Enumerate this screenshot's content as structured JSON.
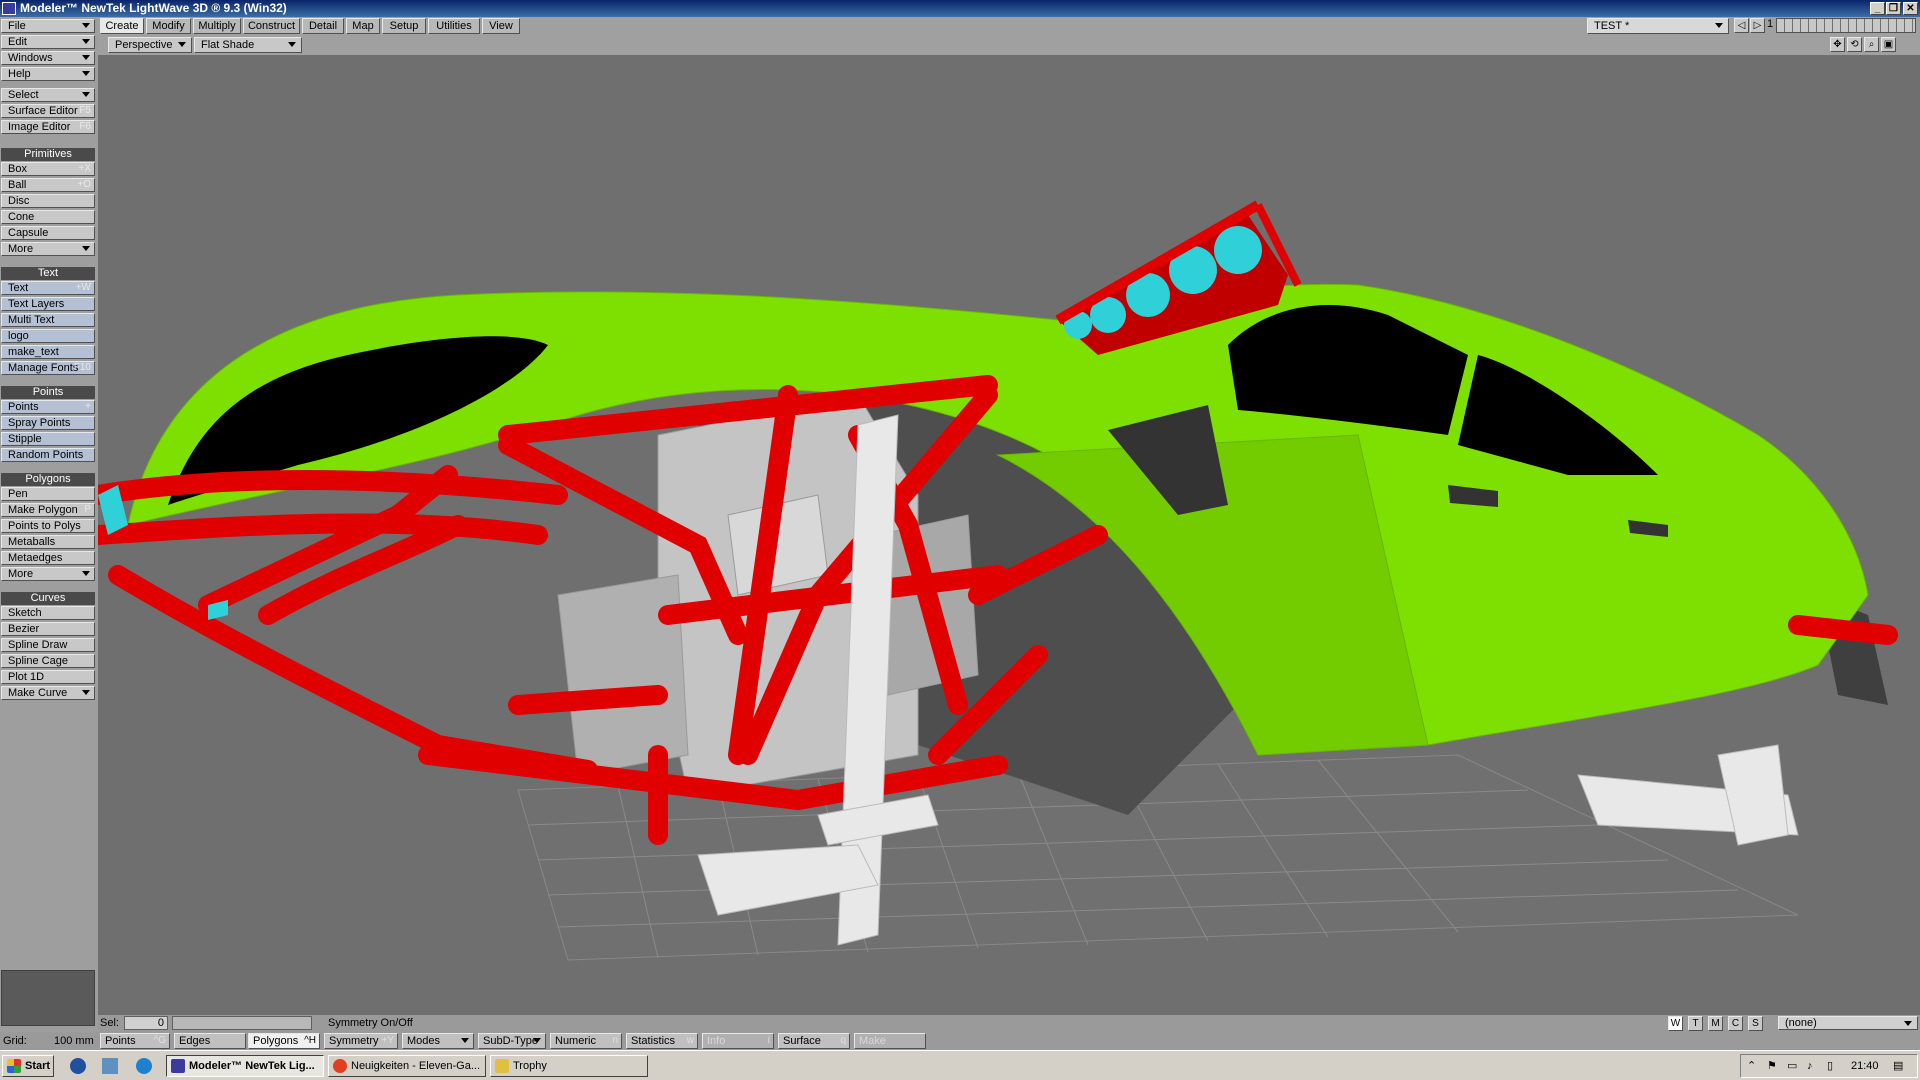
{
  "window": {
    "title": "Modeler™ NewTek LightWave 3D ® 9.3 (Win32)"
  },
  "sidebar": {
    "menus": [
      {
        "label": "File"
      },
      {
        "label": "Edit"
      },
      {
        "label": "Windows"
      },
      {
        "label": "Help"
      }
    ],
    "tools": [
      {
        "label": "Select"
      },
      {
        "label": "Surface Editor",
        "shortcut": "F5"
      },
      {
        "label": "Image Editor",
        "shortcut": "F6"
      }
    ],
    "groups": [
      {
        "title": "Primitives",
        "items": [
          {
            "label": "Box",
            "shortcut": "+X"
          },
          {
            "label": "Ball",
            "shortcut": "+O"
          },
          {
            "label": "Disc",
            "shortcut": ""
          },
          {
            "label": "Cone",
            "shortcut": ""
          },
          {
            "label": "Capsule",
            "shortcut": ""
          },
          {
            "label": "More",
            "shortcut": ""
          }
        ]
      },
      {
        "title": "Text",
        "items": [
          {
            "label": "Text",
            "shortcut": "+W"
          },
          {
            "label": "Text Layers",
            "shortcut": ""
          },
          {
            "label": "Multi Text",
            "shortcut": ""
          },
          {
            "label": "logo",
            "shortcut": ""
          },
          {
            "label": "make_text",
            "shortcut": ""
          },
          {
            "label": "Manage Fonts",
            "shortcut": "F10"
          }
        ]
      },
      {
        "title": "Points",
        "items": [
          {
            "label": "Points",
            "shortcut": "+"
          },
          {
            "label": "Spray Points",
            "shortcut": ""
          },
          {
            "label": "Stipple",
            "shortcut": ""
          },
          {
            "label": "Random Points",
            "shortcut": ""
          }
        ]
      },
      {
        "title": "Polygons",
        "items": [
          {
            "label": "Pen",
            "shortcut": ""
          },
          {
            "label": "Make Polygon",
            "shortcut": "P"
          },
          {
            "label": "Points to Polys",
            "shortcut": ""
          },
          {
            "label": "Metaballs",
            "shortcut": ""
          },
          {
            "label": "Metaedges",
            "shortcut": ""
          },
          {
            "label": "More",
            "shortcut": ""
          }
        ]
      },
      {
        "title": "Curves",
        "items": [
          {
            "label": "Sketch",
            "shortcut": ""
          },
          {
            "label": "Bezier",
            "shortcut": ""
          },
          {
            "label": "Spline Draw",
            "shortcut": ""
          },
          {
            "label": "Spline Cage",
            "shortcut": ""
          },
          {
            "label": "Plot 1D",
            "shortcut": ""
          },
          {
            "label": "Make Curve",
            "shortcut": ""
          }
        ]
      }
    ]
  },
  "tabs": [
    {
      "label": "Create"
    },
    {
      "label": "Modify"
    },
    {
      "label": "Multiply"
    },
    {
      "label": "Construct"
    },
    {
      "label": "Detail"
    },
    {
      "label": "Map"
    },
    {
      "label": "Setup"
    },
    {
      "label": "Utilities"
    },
    {
      "label": "View"
    }
  ],
  "object_selector": {
    "value": "TEST *"
  },
  "layer_indicator": "1",
  "viewport": {
    "view_mode": "Perspective",
    "render_mode": "Flat Shade"
  },
  "statusbar": {
    "sel_label": "Sel:",
    "sel_value": "0",
    "hint": "Symmetry On/Off",
    "grid_label": "Grid:",
    "grid_value": "100 mm",
    "wtmcs": [
      "W",
      "T",
      "M",
      "C",
      "S"
    ],
    "surface_value": "(none)"
  },
  "bottombar": {
    "points": {
      "label": "Points",
      "shortcut": "^G"
    },
    "edges": {
      "label": "Edges",
      "shortcut": ""
    },
    "polygons": {
      "label": "Polygons",
      "shortcut": "^H"
    },
    "symmetry": {
      "label": "Symmetry",
      "shortcut": "+Y"
    },
    "modes": {
      "label": "Modes"
    },
    "subd": {
      "label": "SubD-Type"
    },
    "numeric": {
      "label": "Numeric",
      "shortcut": "n"
    },
    "statistics": {
      "label": "Statistics",
      "shortcut": "w"
    },
    "info": {
      "label": "Info",
      "shortcut": "i"
    },
    "surface": {
      "label": "Surface",
      "shortcut": "q"
    },
    "make": {
      "label": "Make"
    }
  },
  "taskbar": {
    "start": "Start",
    "windows": [
      {
        "label": "Modeler™ NewTek Lig..."
      },
      {
        "label": "Neuigkeiten - Eleven-Ga..."
      },
      {
        "label": "Trophy"
      }
    ],
    "clock": "21:40"
  },
  "colors": {
    "body_green": "#7fe000",
    "frame_red": "#e00000",
    "light_cyan": "#30d0d8"
  }
}
